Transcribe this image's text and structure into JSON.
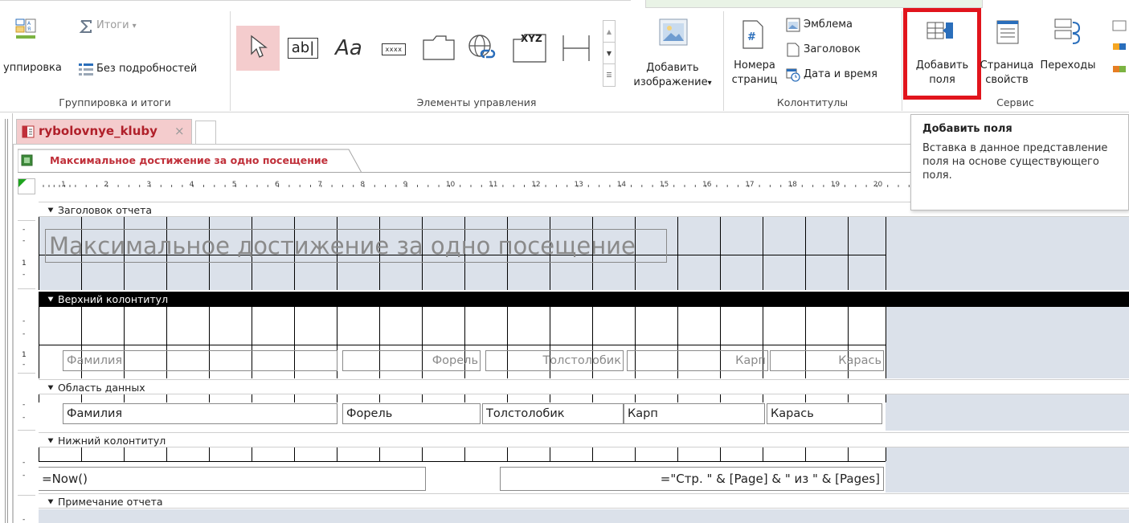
{
  "ribbon": {
    "grouping_group": {
      "label": "Группировка и итоги",
      "group_button": "уппировка",
      "totals_button": "Итоги",
      "totals_arrow": "▾",
      "no_details_button": "Без подробностей"
    },
    "controls_group": {
      "label": "Элементы управления",
      "textbox_label": "ab|",
      "label_label": "Aa",
      "button_label": "xxxx",
      "combo_label": "XYZ",
      "add_image_line1": "Добавить",
      "add_image_line2": "изображение",
      "add_image_arrow": "▾"
    },
    "header_footer_group": {
      "label": "Колонтитулы",
      "page_numbers_line1": "Номера",
      "page_numbers_line2": "страниц",
      "logo": "Эмблема",
      "title": "Заголовок",
      "date_time": "Дата и время"
    },
    "tools_group": {
      "label": "Сервис",
      "add_fields_line1": "Добавить",
      "add_fields_line2": "поля",
      "property_sheet_line1": "Страница",
      "property_sheet_line2": "свойств",
      "tab_order": "Переходы"
    }
  },
  "tooltip": {
    "title": "Добавить поля",
    "body": "Вставка в данное представление поля на основе существующего поля."
  },
  "document": {
    "tab_title": "rybolovnye_kluby",
    "tab_close": "×",
    "report_tab_title": "Максимальное достижение за одно посещение"
  },
  "ruler": {
    "ticks": [
      "1",
      "2",
      "3",
      "4",
      "5",
      "6",
      "7",
      "8",
      "9",
      "10",
      "11",
      "12",
      "13",
      "14",
      "15",
      "16",
      "17",
      "18",
      "19",
      "20"
    ]
  },
  "vruler": {
    "report_header_mark": "1",
    "page_header_mark": "1"
  },
  "report": {
    "report_header_label": "Заголовок отчета",
    "report_title": "Максимальное достижение за одно посещение",
    "page_header_label": "Верхний колонтитул",
    "page_header_fields": [
      "Фамилия",
      "Форель",
      "Толстолобик",
      "Карп",
      "Карась"
    ],
    "detail_label": "Область данных",
    "detail_fields": [
      "Фамилия",
      "Форель",
      "Толстолобик",
      "Карп",
      "Карась"
    ],
    "page_footer_label": "Нижний колонтитул",
    "page_footer_left": "=Now()",
    "page_footer_right": "=\"Стр. \" & [Page] & \" из \" & [Pages]",
    "report_footer_label": "Примечание отчета"
  },
  "colors": {
    "highlight": "#e1141c",
    "tab_bg": "#f4cccd",
    "title_text": "#c0303a",
    "design_gray": "#dbe1ea"
  },
  "icons": [
    "sort-icon",
    "sum-icon",
    "no-details-icon",
    "select-pointer-icon",
    "hyperlink-icon",
    "image-icon",
    "page-number-icon",
    "logo-icon",
    "title-icon",
    "datetime-icon",
    "add-fields-icon",
    "property-sheet-icon",
    "tab-order-icon",
    "report-icon",
    "section-arrow-icon"
  ]
}
